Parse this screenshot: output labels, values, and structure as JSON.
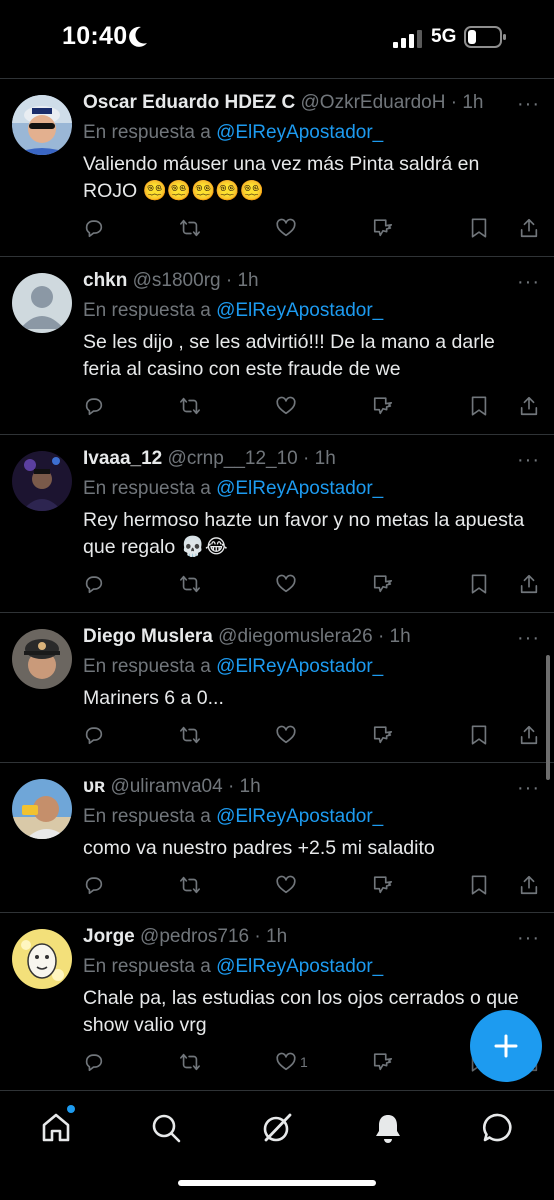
{
  "status_bar": {
    "time": "10:40",
    "network": "5G"
  },
  "reply_prefix": "En respuesta a",
  "reply_target": "@ElReyApostador_",
  "tweets": [
    {
      "name": "Oscar Eduardo HDEZ C",
      "handle": "@OzkrEduardoH",
      "dot": "·",
      "time": "1h",
      "text": "Valiendo máuser una vez más Pinta saldrá en ROJO 😵‍💫😵‍💫😵‍💫😵‍💫😵‍💫",
      "likes": ""
    },
    {
      "name": "chkn",
      "handle": "@s1800rg",
      "dot": "·",
      "time": "1h",
      "text": "Se les dijo , se les advirtió!!! De la mano a darle feria al casino con este fraude de we",
      "likes": ""
    },
    {
      "name": "Ivaaa_12",
      "handle": "@crnp__12_10",
      "dot": "·",
      "time": "1h",
      "text": "Rey hermoso hazte un favor y no metas la apuesta que regalo 💀😂",
      "likes": ""
    },
    {
      "name": "Diego Muslera",
      "handle": "@diegomuslera26",
      "dot": "·",
      "time": "1h",
      "text": "Mariners 6 a 0...",
      "likes": ""
    },
    {
      "name": "ᴜʀ",
      "handle": "@uliramva04",
      "dot": "·",
      "time": "1h",
      "text": "como va nuestro padres +2.5 mi saladito",
      "likes": ""
    },
    {
      "name": "Jorge",
      "handle": "@pedros716",
      "dot": "·",
      "time": "1h",
      "text": "Chale pa, las estudias con los ojos cerrados o que show valio vrg",
      "likes": "1"
    }
  ],
  "colors": {
    "accent": "#1d9bf0",
    "background": "#000000",
    "secondary_text": "#71767b",
    "divider": "#2f3336"
  },
  "icons": {
    "reply": "reply-icon",
    "retweet": "retweet-icon",
    "like": "heart-icon",
    "stats": "views-icon",
    "bookmark": "bookmark-icon",
    "share": "share-icon",
    "compose": "plus-icon",
    "tabs": [
      "home-icon",
      "search-icon",
      "grok-icon",
      "bell-icon",
      "messages-icon"
    ]
  }
}
